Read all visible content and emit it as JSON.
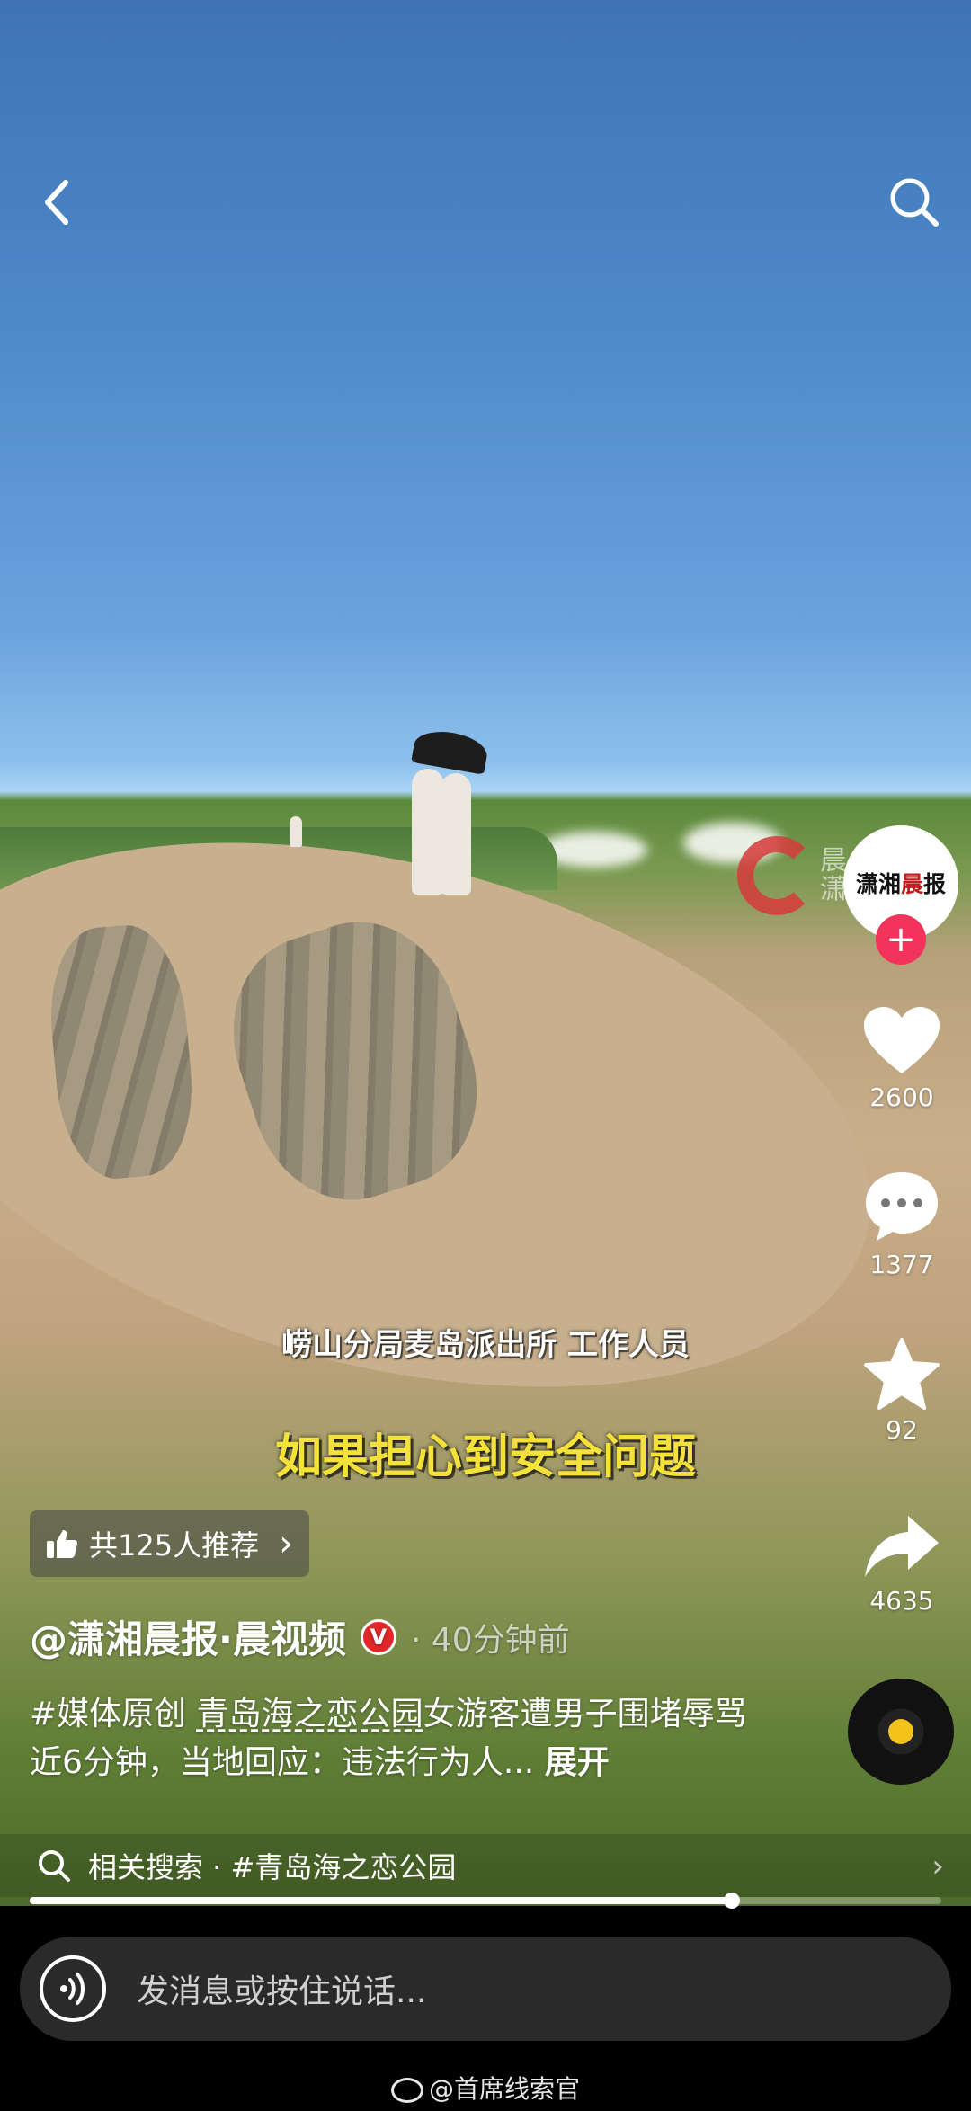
{
  "header": {
    "back_icon": "chevron-left-icon",
    "search_icon": "search-icon"
  },
  "overlay_logo": {
    "side_text_1": "晨",
    "side_text_2": "潇"
  },
  "author_avatar": {
    "text_a": "潇湘",
    "text_b": "晨",
    "text_c": "报",
    "follow_symbol": "+"
  },
  "actions": {
    "likes": "2600",
    "comments": "1377",
    "favorites": "92",
    "shares": "4635"
  },
  "subtitles": {
    "line1": "崂山分局麦岛派出所 工作人员",
    "line2": "如果担心到安全问题"
  },
  "recommend": {
    "label": "共125人推荐",
    "chevron": "›"
  },
  "author": {
    "name": "@潇湘晨报·晨视频",
    "verified": "V",
    "time": "· 40分钟前"
  },
  "description": {
    "tag": "#媒体原创 ",
    "location": "青岛海之恋公园",
    "text": "女游客遭男子围堵辱骂近6分钟，当地回应：违法行为人...",
    "more": "展开"
  },
  "related_search": {
    "label": "相关搜索 · #青岛海之恋公园",
    "chevron": "›"
  },
  "progress": {
    "fraction": 0.77
  },
  "message_bar": {
    "placeholder": "发消息或按住说话..."
  },
  "watermark": {
    "text": "@首席线索官"
  },
  "colors": {
    "accent_red": "#f2335b",
    "subtitle_yellow": "#f4e23b",
    "music_dot": "#f3c21b"
  }
}
